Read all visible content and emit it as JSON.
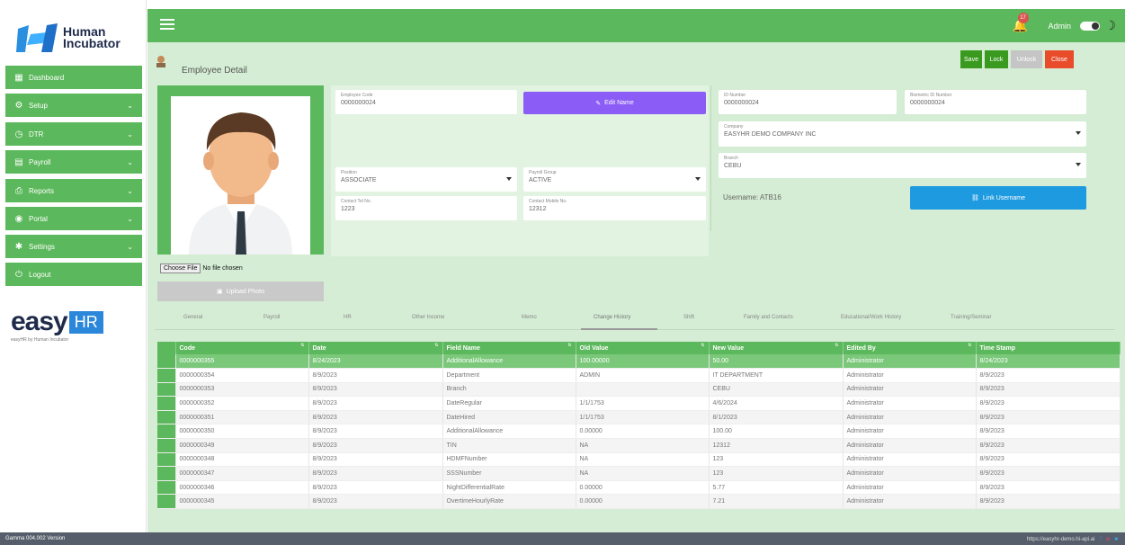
{
  "brand": {
    "line1": "Human",
    "line2": "Incubator"
  },
  "sidebar": {
    "items": [
      {
        "label": "Dashboard",
        "icon": "dashboard-icon",
        "chevron": false
      },
      {
        "label": "Setup",
        "icon": "gear-icon",
        "chevron": true
      },
      {
        "label": "DTR",
        "icon": "clock-icon",
        "chevron": true
      },
      {
        "label": "Payroll",
        "icon": "payroll-icon",
        "chevron": true
      },
      {
        "label": "Reports",
        "icon": "report-icon",
        "chevron": true
      },
      {
        "label": "Portal",
        "icon": "portal-icon",
        "chevron": true
      },
      {
        "label": "Settings",
        "icon": "settings-icon",
        "chevron": true
      },
      {
        "label": "Logout",
        "icon": "power-icon",
        "chevron": false
      }
    ]
  },
  "easy_logo": {
    "easy": "easy",
    "hr": "HR",
    "by": "easyHR by Human Incubator"
  },
  "topbar": {
    "notifications": "17",
    "user": "Admin"
  },
  "page": {
    "title": "Employee Detail",
    "buttons": {
      "save": "Save",
      "lock": "Lock",
      "unlock": "Unlock",
      "close": "Close"
    }
  },
  "photo": {
    "choose_file": "Choose File",
    "no_file": "No file chosen",
    "upload": "Upload Photo"
  },
  "fields": {
    "employee_code": {
      "label": "Employee Code",
      "value": "0000000024"
    },
    "edit_name": "Edit Name",
    "position": {
      "label": "Position",
      "value": "ASSOCIATE"
    },
    "payroll_group": {
      "label": "Payroll Group",
      "value": "ACTIVE"
    },
    "contact_tel": {
      "label": "Contact Tel No.",
      "value": "1223"
    },
    "contact_mobile": {
      "label": "Contact Mobile No.",
      "value": "12312"
    },
    "id_number": {
      "label": "ID Number",
      "value": "0000000024"
    },
    "biometric": {
      "label": "Biometric ID Number",
      "value": "0000000024"
    },
    "company": {
      "label": "Company",
      "value": "EASYHR DEMO COMPANY INC"
    },
    "branch": {
      "label": "Branch",
      "value": "CEBU"
    },
    "username": "Username: ATB16",
    "link_username": "Link Username"
  },
  "tabs": [
    "General",
    "Payroll",
    "HR",
    "Other Income",
    "Memo",
    "Change History",
    "Shift",
    "Family and Contacts",
    "Educational/Work History",
    "Training/Seminar"
  ],
  "table": {
    "columns": [
      "Code",
      "Date",
      "Field Name",
      "Old Value",
      "New Value",
      "Edited By",
      "Time Stamp"
    ],
    "rows": [
      [
        "0000000355",
        "8/24/2023",
        "AdditionalAllowance",
        "100.00000",
        "50.00",
        "Administrator",
        "8/24/2023"
      ],
      [
        "0000000354",
        "8/9/2023",
        "Department",
        "ADMIN",
        "IT DEPARTMENT",
        "Administrator",
        "8/9/2023"
      ],
      [
        "0000000353",
        "8/9/2023",
        "Branch",
        "",
        "CEBU",
        "Administrator",
        "8/9/2023"
      ],
      [
        "0000000352",
        "8/9/2023",
        "DateRegular",
        "1/1/1753",
        "4/6/2024",
        "Administrator",
        "8/9/2023"
      ],
      [
        "0000000351",
        "8/9/2023",
        "DateHired",
        "1/1/1753",
        "8/1/2023",
        "Administrator",
        "8/9/2023"
      ],
      [
        "0000000350",
        "8/9/2023",
        "AdditionalAllowance",
        "0.00000",
        "100.00",
        "Administrator",
        "8/9/2023"
      ],
      [
        "0000000349",
        "8/9/2023",
        "TIN",
        "NA",
        "12312",
        "Administrator",
        "8/9/2023"
      ],
      [
        "0000000348",
        "8/9/2023",
        "HDMFNumber",
        "NA",
        "123",
        "Administrator",
        "8/9/2023"
      ],
      [
        "0000000347",
        "8/9/2023",
        "SSSNumber",
        "NA",
        "123",
        "Administrator",
        "8/9/2023"
      ],
      [
        "0000000346",
        "8/9/2023",
        "NightDifferentialRate",
        "0.00000",
        "5.77",
        "Administrator",
        "8/9/2023"
      ],
      [
        "0000000345",
        "8/9/2023",
        "OvertimeHourlyRate",
        "0.00000",
        "7.21",
        "Administrator",
        "8/9/2023"
      ]
    ]
  },
  "footer": {
    "version": "Gamma 004.002 Version",
    "url": "https://easyhr-demo.hi-api.ai"
  }
}
